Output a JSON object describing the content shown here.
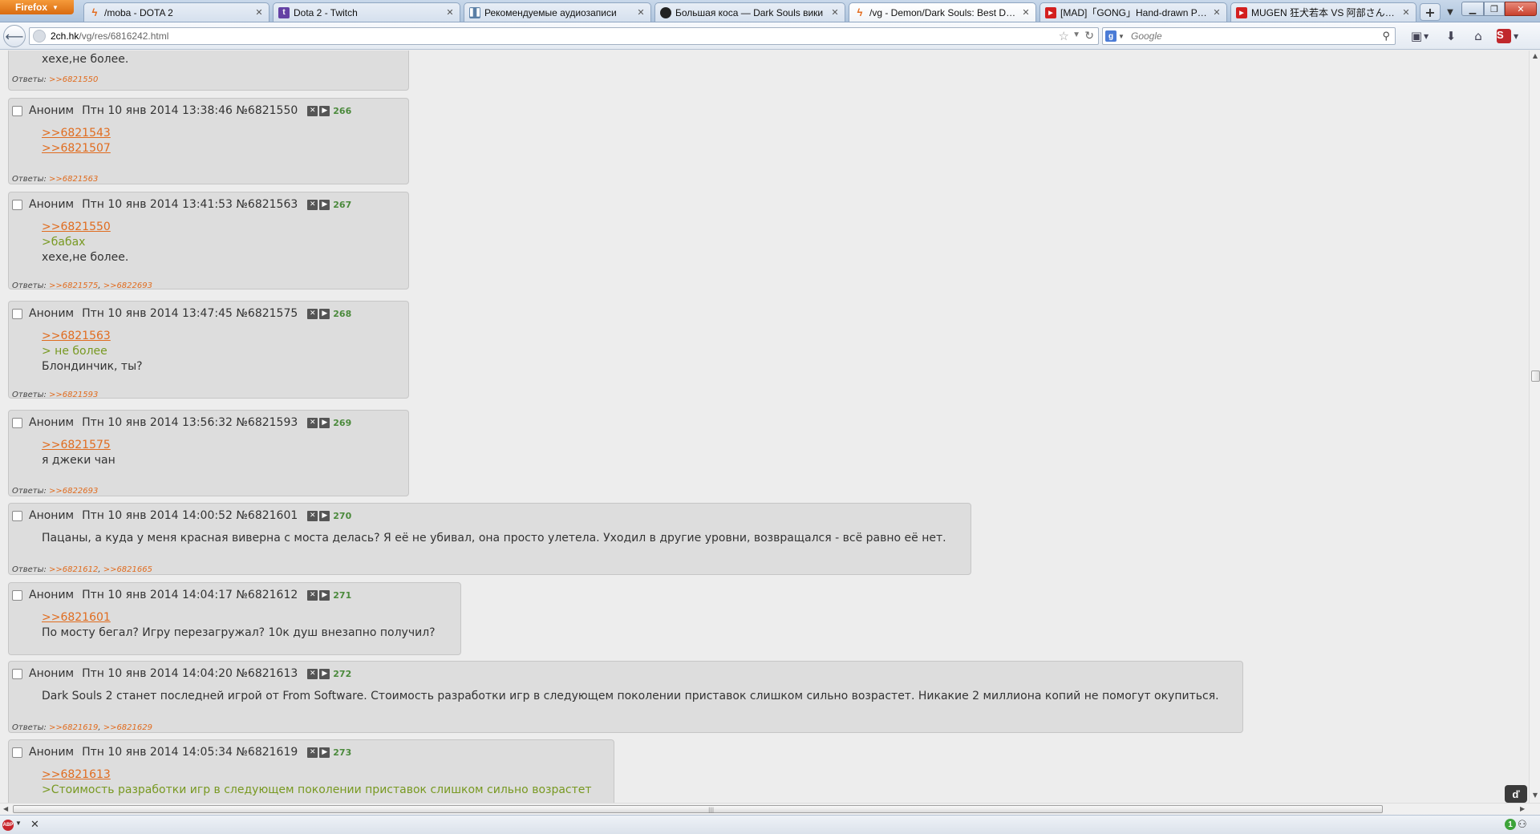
{
  "browser": {
    "menu_label": "Firefox",
    "tabs": [
      {
        "title": "/moba - DOTA 2",
        "icon": "bolt-icon"
      },
      {
        "title": "Dota 2 - Twitch",
        "icon": "twitch-icon"
      },
      {
        "title": "Рекомендуемые аудиозаписи",
        "icon": "pause-icon"
      },
      {
        "title": "Большая коса — Dark Souls вики",
        "icon": "wiki-icon"
      },
      {
        "title": "/vg - Demon/Dark Souls: Best Dex ...",
        "icon": "bolt-icon"
      },
      {
        "title": "[MAD]「GONG」Hand-drawn PV (...",
        "icon": "youtube-icon"
      },
      {
        "title": "MUGEN 狂犬若本 VS 阿部さんカス...",
        "icon": "youtube-icon"
      }
    ],
    "active_tab_index": 4,
    "new_tab_label": "+",
    "url_host": "2ch.hk",
    "url_path": "/vg/res/6816242.html",
    "search_placeholder": "Google",
    "colors": {
      "accent": "#e06c1f",
      "quote": "#789922",
      "post_bg": "#dddddd",
      "post_number": "#4b8a3c"
    }
  },
  "thread": {
    "replies_label": "Ответы:",
    "top_fragment": {
      "text": "хехе,не более.",
      "replies": ">>6821550"
    },
    "posts": [
      {
        "name": "Аноним",
        "date": "Птн 10 янв 2014 13:38:46",
        "no": "№6821550",
        "pos": "266",
        "lines": [
          {
            "t": "link",
            "v": ">>6821543"
          },
          {
            "t": "link",
            "v": ">>6821507"
          }
        ],
        "replies": [
          ">>6821563"
        ]
      },
      {
        "name": "Аноним",
        "date": "Птн 10 янв 2014 13:41:53",
        "no": "№6821563",
        "pos": "267",
        "lines": [
          {
            "t": "link",
            "v": ">>6821550"
          },
          {
            "t": "quote",
            "v": ">бабах"
          },
          {
            "t": "text",
            "v": "хехе,не более."
          }
        ],
        "replies": [
          ">>6821575",
          ">>6822693"
        ]
      },
      {
        "name": "Аноним",
        "date": "Птн 10 янв 2014 13:47:45",
        "no": "№6821575",
        "pos": "268",
        "lines": [
          {
            "t": "link",
            "v": ">>6821563"
          },
          {
            "t": "quote",
            "v": "> не более"
          },
          {
            "t": "text",
            "v": "Блондинчик, ты?"
          }
        ],
        "replies": [
          ">>6821593"
        ]
      },
      {
        "name": "Аноним",
        "date": "Птн 10 янв 2014 13:56:32",
        "no": "№6821593",
        "pos": "269",
        "lines": [
          {
            "t": "link",
            "v": ">>6821575"
          },
          {
            "t": "text",
            "v": "я джеки чан"
          }
        ],
        "replies": [
          ">>6822693"
        ]
      },
      {
        "name": "Аноним",
        "date": "Птн 10 янв 2014 14:00:52",
        "no": "№6821601",
        "pos": "270",
        "lines": [
          {
            "t": "text",
            "v": "Пацаны, а куда у меня красная виверна с моста делась? Я её не убивал, она просто улетела. Уходил в другие уровни, возвращался - всё равно её нет."
          }
        ],
        "replies": [
          ">>6821612",
          ">>6821665"
        ]
      },
      {
        "name": "Аноним",
        "date": "Птн 10 янв 2014 14:04:17",
        "no": "№6821612",
        "pos": "271",
        "lines": [
          {
            "t": "link",
            "v": ">>6821601"
          },
          {
            "t": "text",
            "v": "По мосту бегал? Игру перезагружал? 10к душ внезапно получил?"
          }
        ],
        "replies": []
      },
      {
        "name": "Аноним",
        "date": "Птн 10 янв 2014 14:04:20",
        "no": "№6821613",
        "pos": "272",
        "lines": [
          {
            "t": "text",
            "v": "Dark Souls 2 станет последней игрой от From Software. Стоимость разработки игр в следующем поколении приставок слишком сильно возрастет. Никакие 2 миллиона копий не помогут окупиться."
          }
        ],
        "replies": [
          ">>6821619",
          ">>6821629"
        ]
      },
      {
        "name": "Аноним",
        "date": "Птн 10 янв 2014 14:05:34",
        "no": "№6821619",
        "pos": "273",
        "lines": [
          {
            "t": "link",
            "v": ">>6821613"
          },
          {
            "t": "quote",
            "v": ">Стоимость разработки игр в следующем поколении приставок слишком сильно возрастет"
          }
        ],
        "replies": []
      }
    ]
  }
}
